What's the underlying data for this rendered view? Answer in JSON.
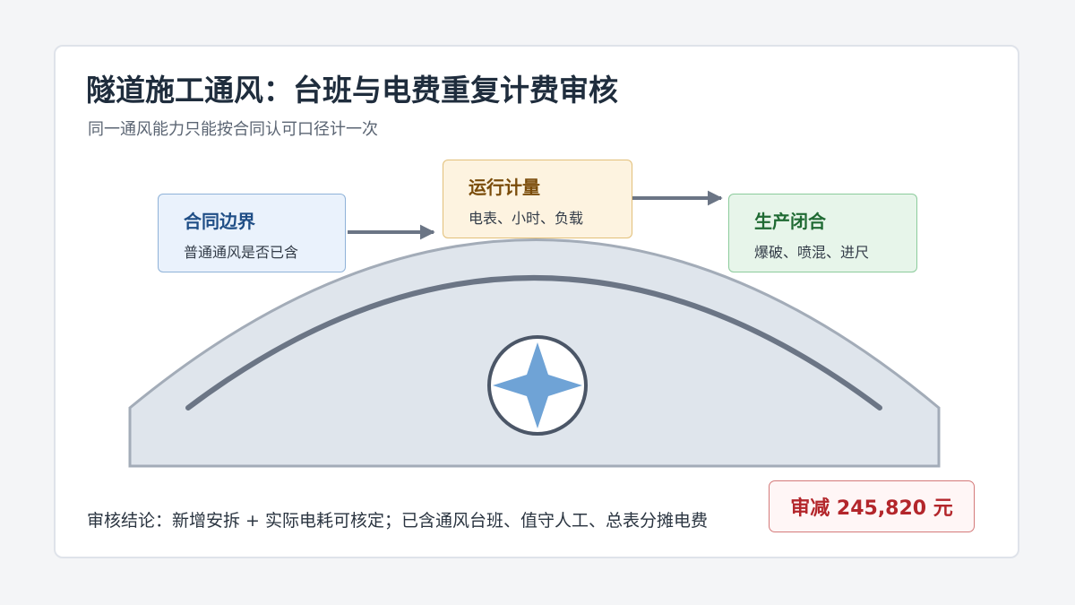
{
  "header": {
    "title": "隧道施工通风：台班与电费重复计费审核",
    "subtitle": "同一通风能力只能按合同认可口径计一次"
  },
  "steps": [
    {
      "title": "合同边界",
      "detail": "普通通风是否已含",
      "color": "#1f4e86"
    },
    {
      "title": "运行计量",
      "detail": "电表、小时、负载",
      "color": "#7a4c0a"
    },
    {
      "title": "生产闭合",
      "detail": "爆破、喷混、进尺",
      "color": "#1f6a33"
    }
  ],
  "center_icon": "fan-icon",
  "footer": {
    "conclusion": "审核结论：新增安拆 + 实际电耗可核定；已含通风台班、值守人工、总表分摊电费",
    "reduction": "审减 245,820 元",
    "reduction_color": "#b3262b"
  }
}
